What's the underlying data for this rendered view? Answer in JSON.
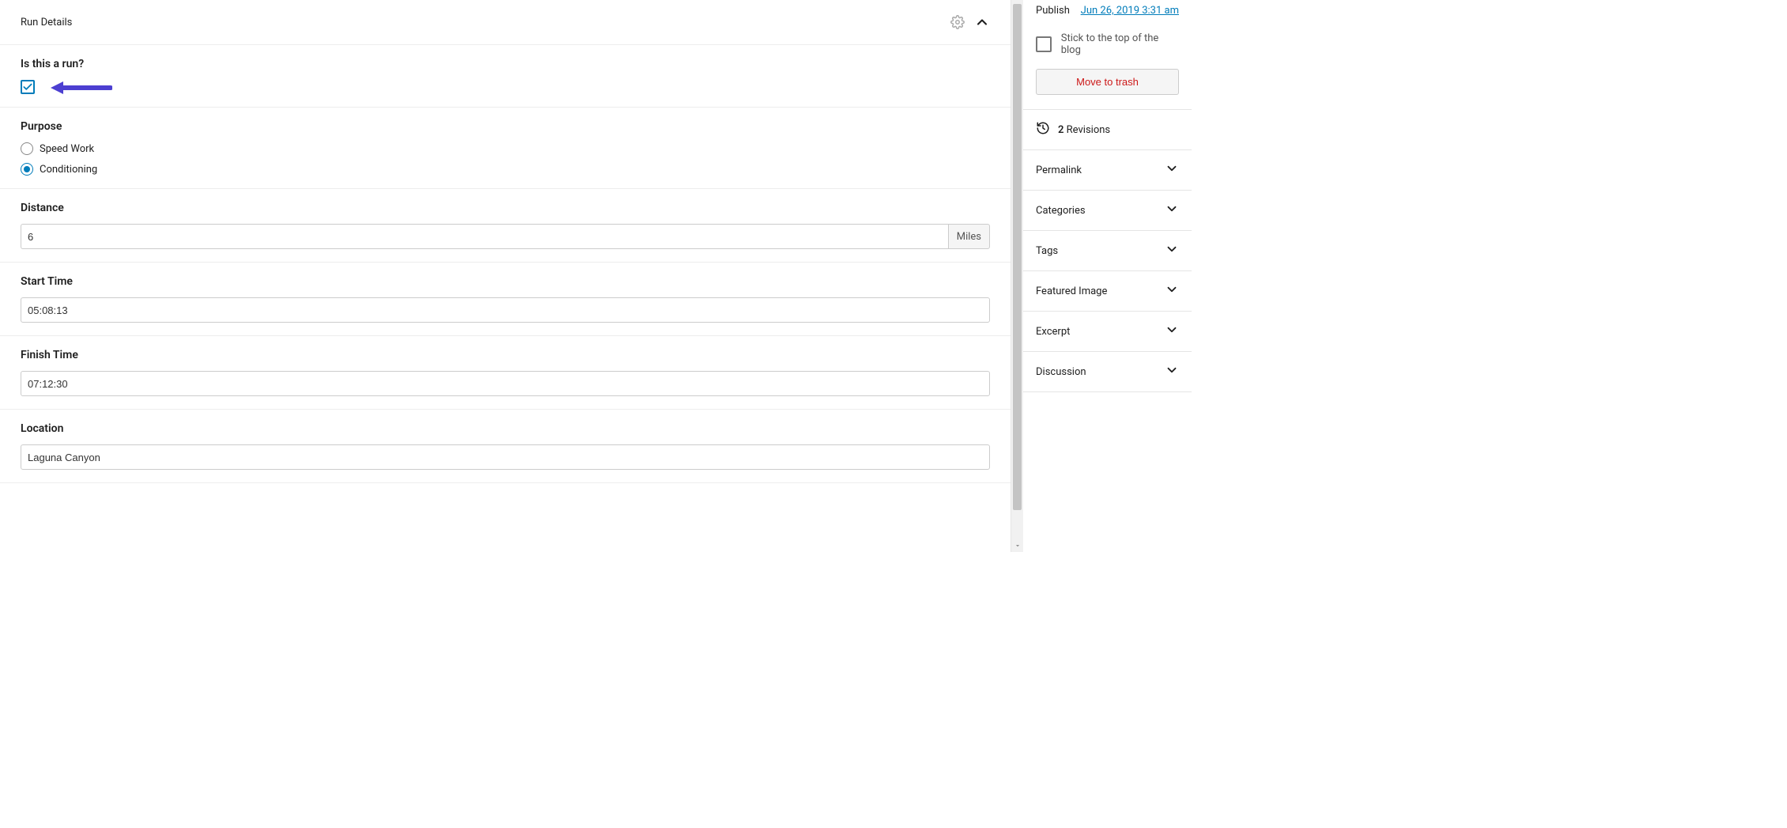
{
  "main": {
    "panel_title": "Run Details",
    "fields": {
      "is_run": {
        "label": "Is this a run?",
        "checked": true
      },
      "purpose": {
        "label": "Purpose",
        "options": [
          {
            "label": "Speed Work",
            "selected": false
          },
          {
            "label": "Conditioning",
            "selected": true
          }
        ]
      },
      "distance": {
        "label": "Distance",
        "value": "6",
        "unit": "Miles"
      },
      "start_time": {
        "label": "Start Time",
        "value": "05:08:13"
      },
      "finish_time": {
        "label": "Finish Time",
        "value": "07:12:30"
      },
      "location": {
        "label": "Location",
        "value": "Laguna Canyon"
      }
    }
  },
  "sidebar": {
    "publish": {
      "label": "Publish",
      "datetime": "Jun 26, 2019 3:31 am"
    },
    "stick": {
      "label": "Stick to the top of the blog",
      "checked": false
    },
    "trash_label": "Move to trash",
    "revisions": {
      "count": "2",
      "label": "Revisions"
    },
    "sections": [
      {
        "label": "Permalink"
      },
      {
        "label": "Categories"
      },
      {
        "label": "Tags"
      },
      {
        "label": "Featured Image"
      },
      {
        "label": "Excerpt"
      },
      {
        "label": "Discussion"
      }
    ]
  }
}
